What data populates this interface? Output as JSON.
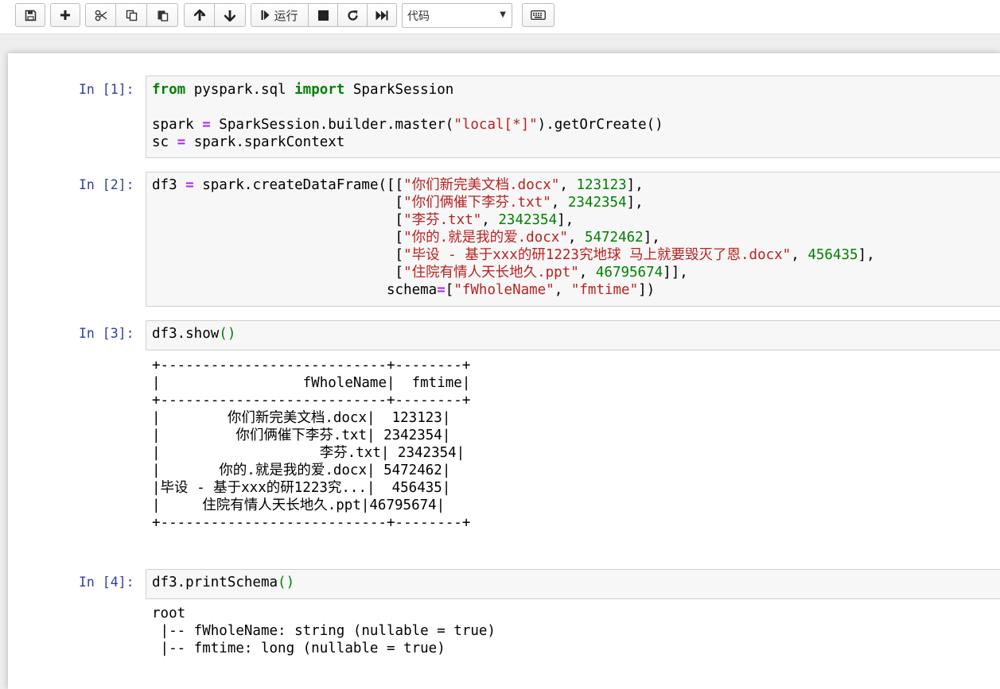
{
  "toolbar": {
    "buttons": [
      {
        "name": "save-button",
        "icon": "floppy-disk-icon"
      },
      {
        "name": "insert-cell-button",
        "icon": "plus-icon"
      },
      {
        "name": "cut-button",
        "icon": "scissors-icon"
      },
      {
        "name": "copy-button",
        "icon": "copy-icon"
      },
      {
        "name": "paste-button",
        "icon": "paste-icon"
      },
      {
        "name": "move-up-button",
        "icon": "arrow-up-icon"
      },
      {
        "name": "move-down-button",
        "icon": "arrow-down-icon"
      },
      {
        "name": "run-button",
        "icon": "step-forward-icon"
      },
      {
        "name": "interrupt-button",
        "icon": "stop-icon"
      },
      {
        "name": "restart-button",
        "icon": "refresh-icon"
      },
      {
        "name": "restart-run-all-button",
        "icon": "fast-forward-icon"
      },
      {
        "name": "command-palette-button",
        "icon": "keyboard-icon"
      }
    ],
    "run_label": "运行",
    "cell_type_select": {
      "value": "代码"
    }
  },
  "cells": [
    {
      "prompt": "In [1]:",
      "lines": [
        "from pyspark.sql import SparkSession",
        "",
        "spark = SparkSession.builder.master(\"local[*]\").getOrCreate()",
        "sc = spark.sparkContext"
      ]
    },
    {
      "prompt": "In [2]:",
      "lines": [
        "df3 = spark.createDataFrame([[\"你们新完美文档.docx\", 123123],",
        "                             [\"你们俩催下李芬.txt\", 2342354],",
        "                             [\"李芬.txt\", 2342354],",
        "                             [\"你的.就是我的爱.docx\", 5472462],",
        "                             [\"毕设 - 基于xxx的研1223究地球 马上就要毁灭了恩.docx\", 456435],",
        "                             [\"住院有情人天长地久.ppt\", 46795674]],",
        "                            schema=[\"fWholeName\", \"fmtime\"])"
      ]
    },
    {
      "prompt": "In [3]:",
      "lines": [
        "df3.show()"
      ],
      "output": [
        "+---------------------------+--------+",
        "|                 fWholeName|  fmtime|",
        "+---------------------------+--------+",
        "|        你们新完美文档.docx|  123123|",
        "|         你们俩催下李芬.txt| 2342354|",
        "|                   李芬.txt| 2342354|",
        "|       你的.就是我的爱.docx| 5472462|",
        "|毕设 - 基于xxx的研1223究...|  456435|",
        "|     住院有情人天长地久.ppt|46795674|",
        "+---------------------------+--------+"
      ]
    },
    {
      "prompt": "In [4]:",
      "lines": [
        "df3.printSchema()"
      ],
      "output": [
        "root",
        " |-- fWholeName: string (nullable = true)",
        " |-- fmtime: long (nullable = true)"
      ]
    }
  ]
}
